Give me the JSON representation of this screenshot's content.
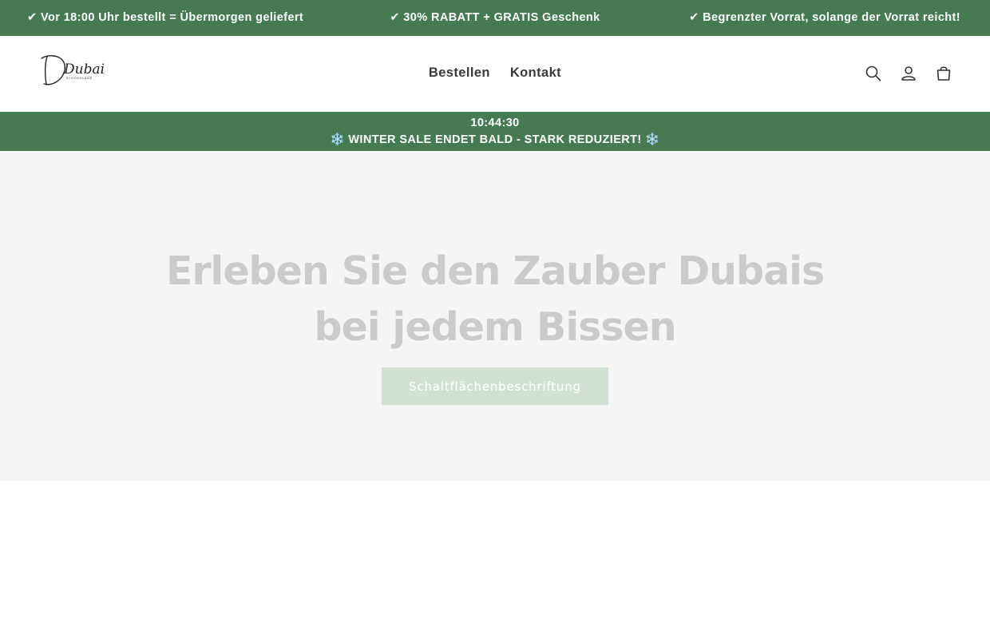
{
  "announcement_bar": {
    "messages": [
      "✔ Vor 18:00 Uhr bestellt = Übermorgen geliefert",
      "✔ 30% RABATT + GRATIS Geschenk",
      "✔ Begrenzter Vorrat, solange der Vorrat reicht!"
    ]
  },
  "header": {
    "logo": {
      "text": "Dubai",
      "subtext": "SCHOKOLADE"
    },
    "nav": [
      {
        "label": "Bestellen"
      },
      {
        "label": "Kontakt"
      }
    ],
    "icons": [
      "search-icon",
      "account-icon",
      "cart-icon"
    ]
  },
  "sale_bar": {
    "timer": "10:44:30",
    "text": "❄️ WINTER SALE ENDET BALD - STARK REDUZIERT! ❄️"
  },
  "hero": {
    "title": "Erleben Sie den Zauber Dubais bei jedem Bissen",
    "button_label": "Schaltflächenbeschriftung"
  },
  "colors": {
    "brand_green": "#467b52",
    "hero_background": "#f5f5f5",
    "hero_title": "#cbcbcb",
    "hero_button": "#d3e1d5"
  }
}
